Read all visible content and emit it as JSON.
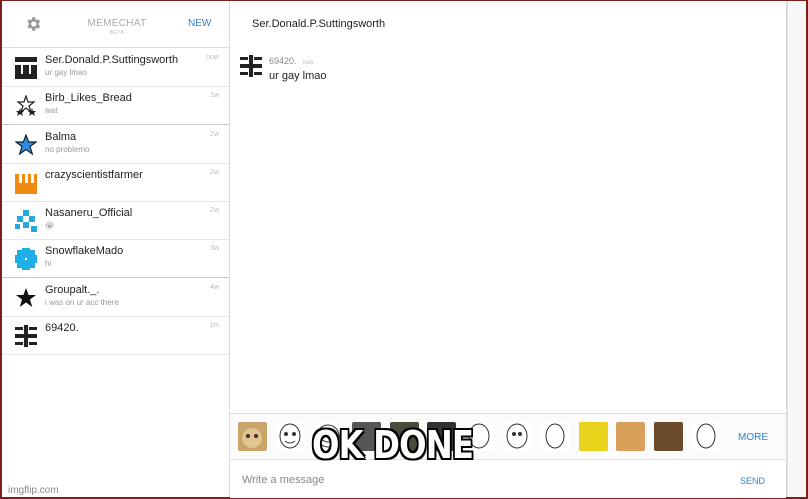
{
  "sidebar": {
    "settings_icon": "gear-icon",
    "brand": "MEMECHAT",
    "brand_sub": "BETA",
    "new_label": "NEW",
    "contacts": [
      {
        "name": "Ser.Donald.P.Suttingsworth",
        "last_message": "ur gay lmao",
        "time": "now",
        "avatar": "bars-pattern-icon"
      },
      {
        "name": "Birb_Likes_Bread",
        "last_message": "wat",
        "time": "1w",
        "avatar": "stars-pattern-icon"
      },
      {
        "name": "Balma",
        "last_message": "no problemo",
        "time": "2w",
        "avatar": "blue-star-icon"
      },
      {
        "name": "crazyscientistfarmer",
        "last_message": "",
        "time": "2w",
        "avatar": "orange-blocks-icon"
      },
      {
        "name": "Nasaneru_Official",
        "last_message": "😭",
        "time": "2w",
        "avatar": "blue-pixel-icon"
      },
      {
        "name": "SnowflakeMado",
        "last_message": "hi",
        "time": "3w",
        "avatar": "snowflake-pixel-icon"
      },
      {
        "name": "Groupalt._.",
        "last_message": "i was on ur acc there",
        "time": "4w",
        "avatar": "black-star-icon"
      },
      {
        "name": "69420.",
        "last_message": "",
        "time": "1m",
        "avatar": "glyph-pattern-icon"
      }
    ]
  },
  "conversation": {
    "title": "Ser.Donald.P.Suttingsworth",
    "messages": [
      {
        "sender": "69420.",
        "time": "now",
        "text": "ur gay lmao",
        "avatar": "glyph-pattern-icon"
      }
    ],
    "sticker_count": 13,
    "more_label": "MORE",
    "input_placeholder": "Write a message",
    "send_label": "SEND"
  },
  "overlay": {
    "caption": "OK DONE",
    "watermark": "imgflip.com"
  },
  "colors": {
    "accent": "#2a86d6",
    "border_frame": "#7a1e1e",
    "muted_text": "#999999"
  }
}
